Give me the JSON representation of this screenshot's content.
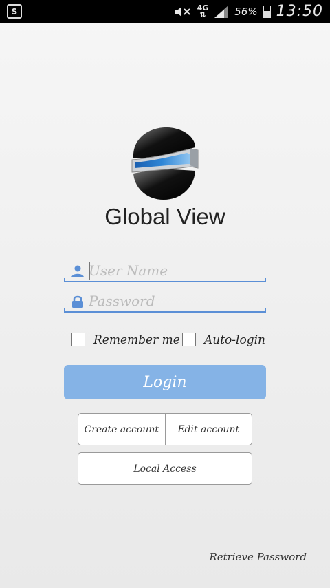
{
  "status_bar": {
    "app_icon_letter": "S",
    "network_type": "4G",
    "battery_percent": "56%",
    "battery_level": 0.56,
    "time": "13:50"
  },
  "brand": {
    "name": "Global View",
    "logo_icon": "globe-logo-icon",
    "accent_color": "#2f86d6"
  },
  "login_form": {
    "username_placeholder": "User Name",
    "username_value": "",
    "password_placeholder": "Password",
    "password_value": "",
    "remember_me_label": "Remember me",
    "remember_me_checked": false,
    "auto_login_label": "Auto-login",
    "auto_login_checked": false,
    "login_label": "Login",
    "login_button_color": "#85b3e6"
  },
  "account_actions": {
    "create_account_label": "Create account",
    "edit_account_label": "Edit account",
    "local_access_label": "Local Access"
  },
  "footer": {
    "retrieve_password_label": "Retrieve Password"
  }
}
